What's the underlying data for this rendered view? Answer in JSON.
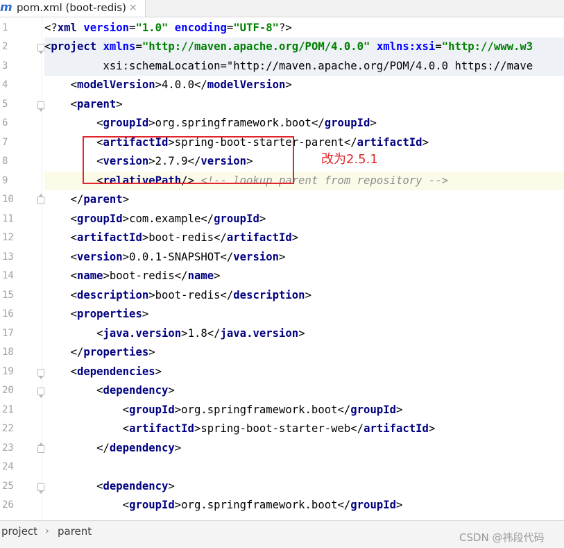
{
  "tab": {
    "icon": "maven-m-icon",
    "icon_glyph": "m",
    "label": "pom.xml (boot-redis)",
    "close": "×"
  },
  "gutter": {
    "line_numbers": [
      "1",
      "2",
      "3",
      "4",
      "5",
      "6",
      "7",
      "8",
      "9",
      "10",
      "11",
      "12",
      "13",
      "14",
      "15",
      "16",
      "17",
      "18",
      "19",
      "20",
      "21",
      "22",
      "23",
      "24",
      "25",
      "26"
    ]
  },
  "code": {
    "lines": [
      "<?xml version=\"1.0\" encoding=\"UTF-8\"?>",
      "<project xmlns=\"http://maven.apache.org/POM/4.0.0\" xmlns:xsi=\"http://www.w3",
      "         xsi:schemaLocation=\"http://maven.apache.org/POM/4.0.0 https://mave",
      "    <modelVersion>4.0.0</modelVersion>",
      "    <parent>",
      "        <groupId>org.springframework.boot</groupId>",
      "        <artifactId>spring-boot-starter-parent</artifactId>",
      "        <version>2.7.9</version>",
      "        <relativePath/> <!-- lookup parent from repository -->",
      "    </parent>",
      "    <groupId>com.example</groupId>",
      "    <artifactId>boot-redis</artifactId>",
      "    <version>0.0.1-SNAPSHOT</version>",
      "    <name>boot-redis</name>",
      "    <description>boot-redis</description>",
      "    <properties>",
      "        <java.version>1.8</java.version>",
      "    </properties>",
      "    <dependencies>",
      "        <dependency>",
      "            <groupId>org.springframework.boot</groupId>",
      "            <artifactId>spring-boot-starter-web</artifactId>",
      "        </dependency>",
      "",
      "        <dependency>",
      "            <groupId>org.springframework.boot</groupId>"
    ]
  },
  "annotation": {
    "text": "改为2.5.1",
    "color": "#e0262d"
  },
  "breadcrumb": {
    "items": [
      "project",
      "parent"
    ],
    "separator": "›"
  },
  "watermark": "CSDN @祎段代码",
  "colors": {
    "tag": "#000080",
    "attribute": "#0000ff",
    "string": "#008000",
    "comment": "#8c8c8c",
    "current_line": "#fcfbea"
  }
}
